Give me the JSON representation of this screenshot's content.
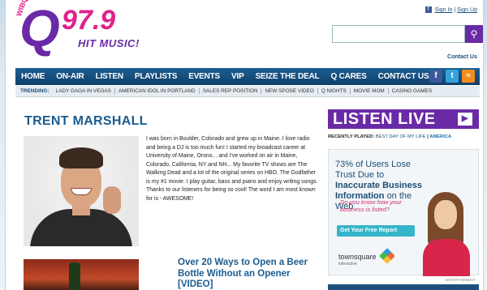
{
  "logo": {
    "callsign": "WIBQ",
    "q": "Q",
    "frequency": "97.9",
    "slogan": "HIT MUSIC!"
  },
  "auth": {
    "sign_in": "Sign In",
    "separator": "|",
    "sign_up": "Sign Up"
  },
  "search": {
    "placeholder": "",
    "button_icon": "search-icon"
  },
  "contact_us_top": "Contact Us",
  "nav": {
    "items": [
      "HOME",
      "ON-AIR",
      "LISTEN",
      "PLAYLISTS",
      "EVENTS",
      "VIP",
      "SEIZE THE DEAL",
      "Q CARES",
      "CONTACT US"
    ],
    "social": [
      "facebook-icon",
      "twitter-icon",
      "rss-icon"
    ]
  },
  "trending": {
    "label": "TRENDING:",
    "items": [
      "LADY GAGA IN VEGAS",
      "AMERICAN IDOL IN PORTLAND",
      "SALES REP POSITION",
      "NEW SPOSE VIDEO",
      "Q NIGHTS",
      "MOVIE MOM",
      "CASINO GAMES"
    ]
  },
  "main": {
    "title": "TRENT MARSHALL",
    "bio": "I was born in Boulder, Colorado and grew up in Maine. I love radio and being a DJ is too much fun! I started my broadcast career at University of Maine, Orono... and I've worked on air in Maine, Colorado, California, NY and NH... My favorite TV shows are The Walking Dead and a lot of the original series on HBO. The Godfather is my #1 movie. I play guitar, bass and piano and enjoy writing songs. Thanks to our listeners for being so cool! The word I am most known for is - AWESOME!",
    "article_title": "Over 20 Ways to Open a Beer Bottle Without an Opener [VIDEO]"
  },
  "listen_live": {
    "label": "LISTEN LIVE",
    "play_icon": "play-icon"
  },
  "recently_played": {
    "label": "RECENTLY PLAYED:",
    "song": "BEST DAY OF MY LIFE",
    "separator": "|",
    "artist": "AMERICA"
  },
  "ad": {
    "line1": "73% of Users Lose Trust Due to",
    "line1_bold": "Inaccurate Business Information",
    "line1_end": "on the Web",
    "question": "Do you know how your business is listed?",
    "cta": "Get Your Free Report",
    "brand": "townsquare",
    "brand_sub": "interactive",
    "label": "ADVERTISEMENT"
  }
}
